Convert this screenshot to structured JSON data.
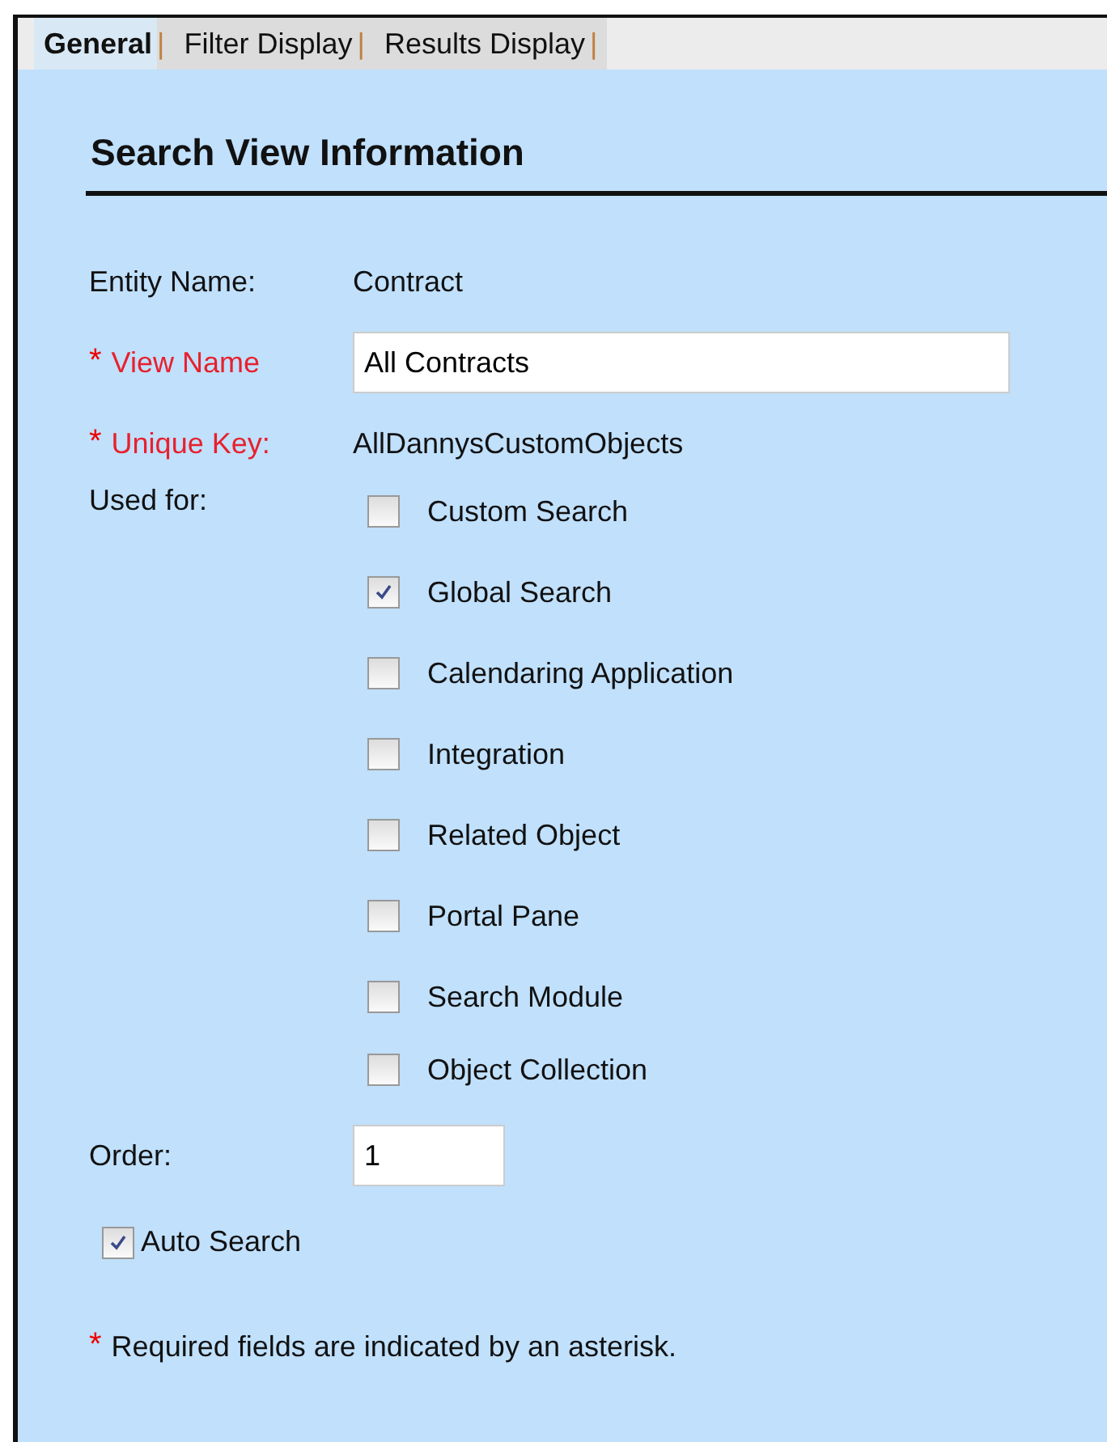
{
  "tabs": [
    {
      "label": "General",
      "separator": "|",
      "selected": true
    },
    {
      "label": "Filter Display",
      "separator": "|",
      "selected": false
    },
    {
      "label": "Results Display",
      "separator": "|",
      "selected": false
    }
  ],
  "section_title": "Search View Information",
  "fields": [
    {
      "kind": "text",
      "label": "Entity Name:",
      "value": "Contract"
    },
    {
      "kind": "input",
      "label": "View Name",
      "asterisk": "*",
      "value": "All Contracts"
    },
    {
      "kind": "text",
      "label": "Unique Key:",
      "asterisk": "*",
      "value": "AllDannysCustomObjects"
    }
  ],
  "used_for": {
    "label": "Used for:",
    "options": [
      {
        "label": "Custom Search",
        "checked": false
      },
      {
        "label": "Global Search",
        "checked": true
      },
      {
        "label": "Calendaring Application",
        "checked": false
      },
      {
        "label": "Integration",
        "checked": false
      },
      {
        "label": "Related Object",
        "checked": false
      },
      {
        "label": "Portal Pane",
        "checked": false
      },
      {
        "label": "Search Module",
        "checked": false
      },
      {
        "label": "Object Collection",
        "checked": false
      }
    ]
  },
  "order": {
    "label": "Order:",
    "value": "1"
  },
  "auto_search": {
    "label": "Auto Search",
    "checked": true
  },
  "footnote": {
    "asterisk": "*",
    "text": "Required fields are indicated by an asterisk."
  }
}
